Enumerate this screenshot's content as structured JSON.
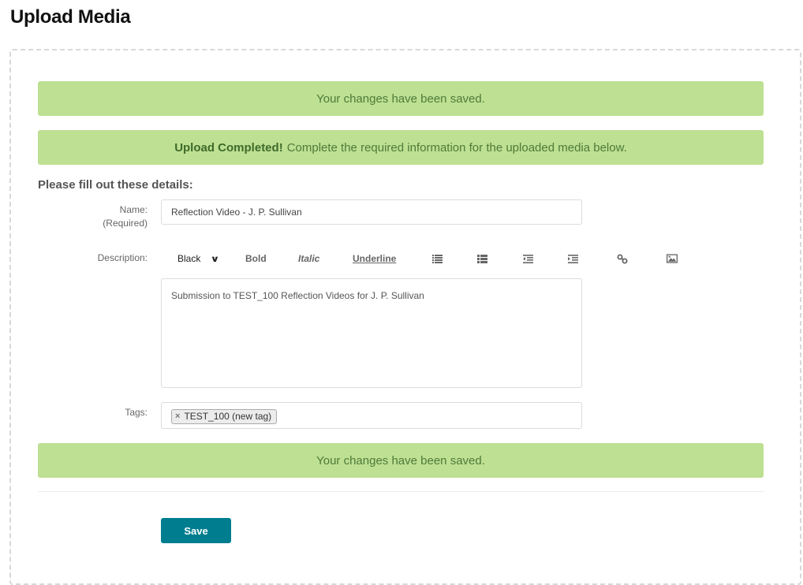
{
  "page": {
    "title": "Upload Media"
  },
  "alerts": {
    "saved_top": "Your changes have been saved.",
    "upload_strong": "Upload Completed!",
    "upload_text": "Complete the required information for the uploaded media below.",
    "saved_bottom": "Your changes have been saved."
  },
  "form": {
    "heading": "Please fill out these details:",
    "name": {
      "label": "Name:",
      "sublabel": "(Required)",
      "value": "Reflection Video - J. P. Sullivan"
    },
    "description": {
      "label": "Description:",
      "value": "Submission to TEST_100 Reflection Videos for J. P. Sullivan",
      "toolbar": {
        "color_value": "Black",
        "bold": "Bold",
        "italic": "Italic",
        "underline": "Underline",
        "icons": [
          "bulleted-list-icon",
          "numbered-list-icon",
          "outdent-icon",
          "indent-icon",
          "link-icon",
          "image-icon"
        ]
      }
    },
    "tags": {
      "label": "Tags:",
      "items": [
        {
          "label": "TEST_100 (new tag)",
          "remove_glyph": "×"
        }
      ]
    },
    "save_label": "Save"
  },
  "colors": {
    "alert_bg": "#bde092",
    "alert_text": "#4f7a3a",
    "primary_button": "#007d8f"
  }
}
